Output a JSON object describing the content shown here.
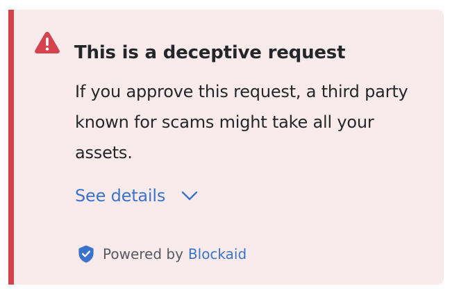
{
  "alert": {
    "severity": "danger",
    "accent_color": "#d5434f",
    "background_color": "#f9ebec",
    "icon": "warning-triangle-icon",
    "title": "This is a deceptive request",
    "description": "If you approve this request, a third party known for scams might take all your assets.",
    "details_link": {
      "label": "See details",
      "icon": "chevron-down-icon",
      "color": "#3a73c9"
    },
    "attribution": {
      "icon": "shield-icon",
      "prefix": "Powered by",
      "provider": "Blockaid"
    }
  }
}
